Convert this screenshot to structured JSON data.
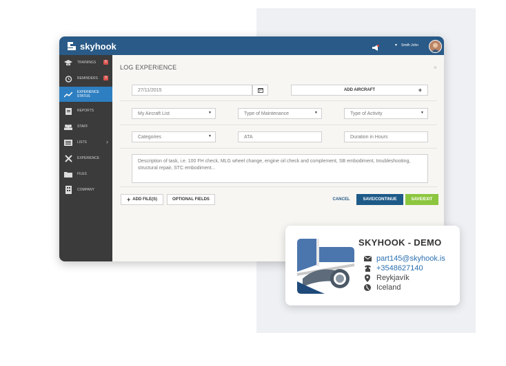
{
  "brand": {
    "name": "skyhook",
    "color": "#2a5a87"
  },
  "header": {
    "user_name": "Smith John",
    "notification_icon": "megaphone-icon"
  },
  "sidebar": {
    "items": [
      {
        "label": "Trainings",
        "icon": "graduation-cap-icon",
        "badge": "5"
      },
      {
        "label": "Reminders",
        "icon": "alarm-clock-icon",
        "badge": "3"
      },
      {
        "label": "Experience Status",
        "icon": "line-chart-icon",
        "active": true
      },
      {
        "label": "Reports",
        "icon": "clipboard-icon"
      },
      {
        "label": "Staff",
        "icon": "users-icon"
      },
      {
        "label": "Lists",
        "icon": "list-icon"
      },
      {
        "label": "Experience",
        "icon": "tools-icon"
      },
      {
        "label": "Files",
        "icon": "folder-icon"
      },
      {
        "label": "Company",
        "icon": "building-icon"
      }
    ]
  },
  "form": {
    "title": "LOG EXPERIENCE",
    "date_value": "27/11/2015",
    "add_aircraft_label": "ADD AIRCRAFT",
    "aircraft_select": "My Aircraft List",
    "maintenance_select": "Type of Maintenance",
    "activity_select": "Type of Activity",
    "categories_select": "Categories",
    "ata_placeholder": "ATA",
    "duration_placeholder": "Duration in Hours",
    "description_placeholder": "Description of task, i.e. 100 FH check, MLG wheel change, engine oil check and complement, SB embodiment, troubleshooting, structural repair, STC embodiment...",
    "add_files_label": "ADD FILE(S)",
    "optional_fields_label": "OPTIONAL FIELDS",
    "cancel_label": "CANCEL",
    "save_continue_label": "SAVE/CONTINUE",
    "save_exit_label": "SAVE/EXIT"
  },
  "card": {
    "title": "SKYHOOK - DEMO",
    "email": "part145@skyhook.is",
    "phone": "+3548627140",
    "city": "Reykjavík",
    "country": "Iceland"
  }
}
